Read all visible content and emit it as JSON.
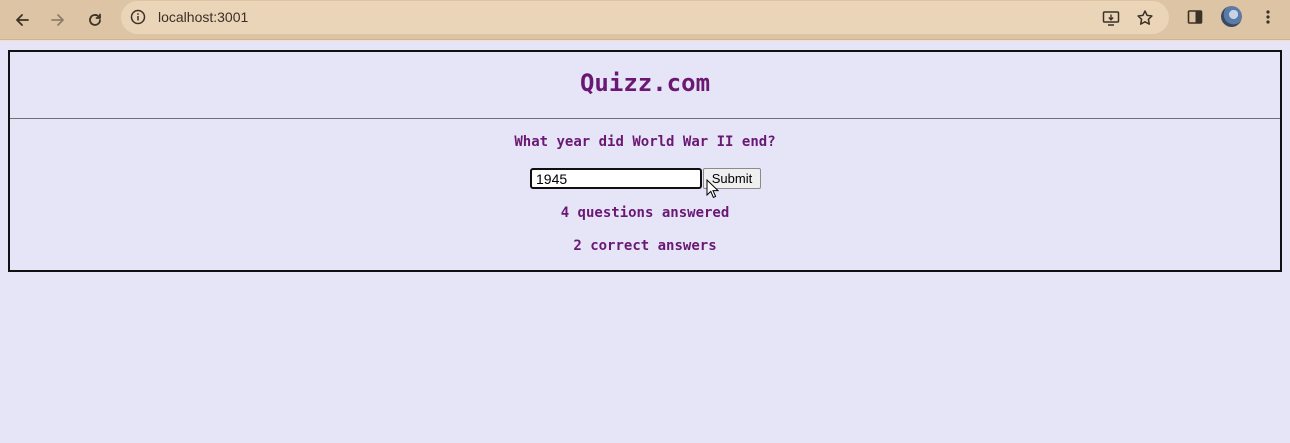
{
  "browser": {
    "url": "localhost:3001",
    "icons": {
      "back": "arrow-left-icon",
      "forward": "arrow-right-icon",
      "reload": "reload-icon",
      "site_info": "info-icon",
      "install": "install-app-icon",
      "bookmark": "star-icon",
      "side_panel": "side-panel-icon",
      "profile": "avatar",
      "menu": "kebab-menu-icon"
    }
  },
  "quiz": {
    "title": "Quizz.com",
    "question": "What year did World War II end?",
    "answer_value": "1945",
    "submit_label": "Submit",
    "questions_answered": "4 questions answered",
    "correct_answers": "2 correct answers"
  },
  "colors": {
    "chrome": "#dcc4a4",
    "page_bg": "#e6e5f8",
    "text_accent": "#6a1873"
  }
}
